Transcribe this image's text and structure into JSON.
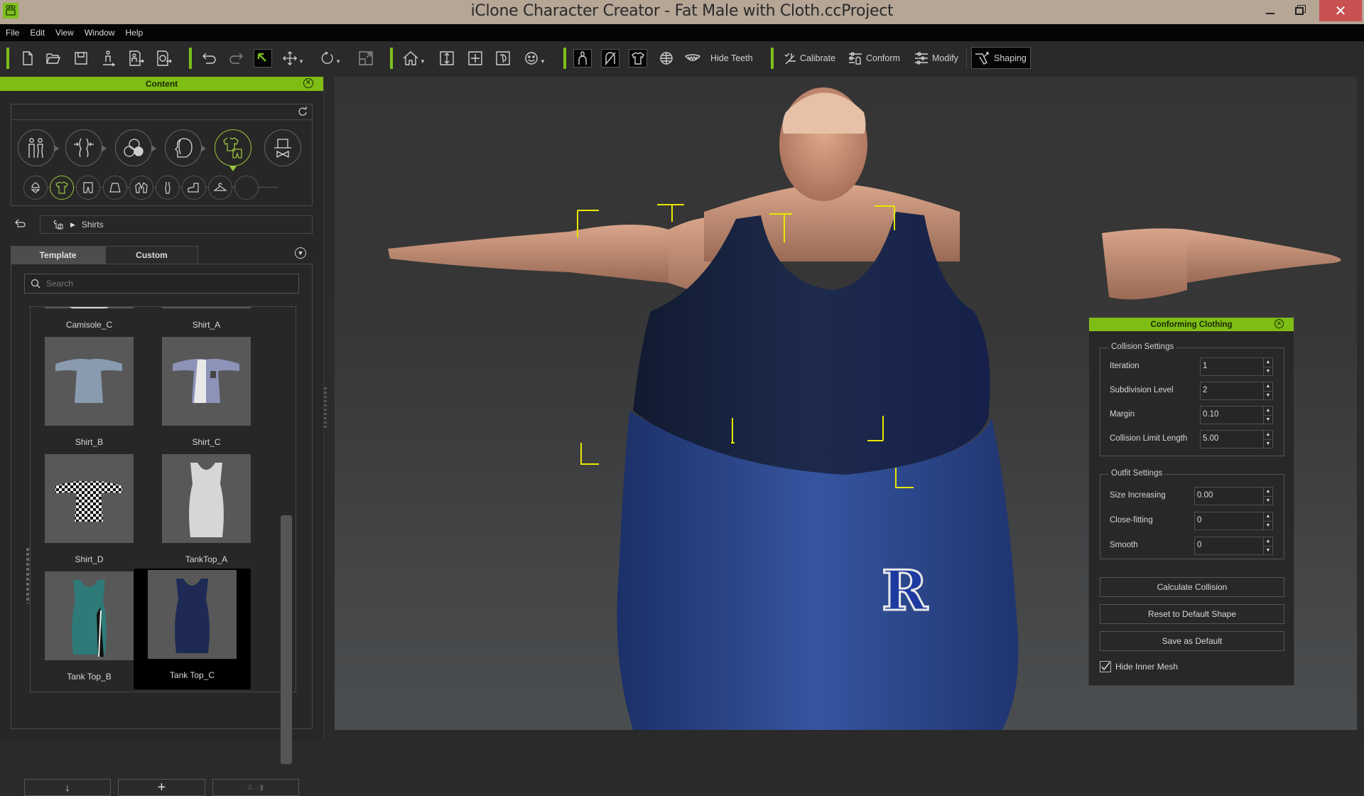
{
  "window": {
    "title": "iClone Character Creator - Fat Male with Cloth.ccProject",
    "controls": {
      "minimize": "—",
      "maximize": "❐",
      "close": "✕"
    }
  },
  "menu": [
    "File",
    "Edit",
    "View",
    "Window",
    "Help"
  ],
  "toolbar": {
    "file_group": [
      "new-file-icon",
      "open-folder-icon",
      "save-icon",
      "export-character-icon",
      "export-fbx-icon",
      "export-obj-icon"
    ],
    "edit_group": [
      "undo-icon",
      "redo-icon",
      "select-arrow-icon",
      "move-icon",
      "rotate-icon",
      "scale-icon"
    ],
    "camera_group": [
      "home-camera-icon",
      "fit-vertical-icon",
      "fit-all-icon",
      "orbit-icon",
      "face-cam-icon"
    ],
    "view_group": [
      "show-body-icon",
      "hide-hair-icon",
      "show-cloth-icon",
      "wireframe-globe-icon",
      "teeth-icon"
    ],
    "hide_teeth_label": "Hide Teeth",
    "calibrate_label": "Calibrate",
    "conform_label": "Conform",
    "modify_label": "Modify",
    "shaping_label": "Shaping",
    "accent": "#7cc01c"
  },
  "content_panel": {
    "title": "Content",
    "categories": [
      {
        "icon": "body-template-icon",
        "active": false
      },
      {
        "icon": "morph-icon",
        "active": false
      },
      {
        "icon": "material-skin-icon",
        "active": false
      },
      {
        "icon": "head-hair-icon",
        "active": false
      },
      {
        "icon": "cloth-icon",
        "active": true
      },
      {
        "icon": "accessory-hat-icon",
        "active": false
      }
    ],
    "subcategories": [
      {
        "icon": "underwear-icon",
        "active": false
      },
      {
        "icon": "shirt-icon",
        "active": true
      },
      {
        "icon": "pants-icon",
        "active": false
      },
      {
        "icon": "skirt-icon",
        "active": false
      },
      {
        "icon": "jacket-icon",
        "active": false
      },
      {
        "icon": "dress-icon",
        "active": false
      },
      {
        "icon": "shoes-icon",
        "active": false
      },
      {
        "icon": "hanger-icon",
        "active": false
      },
      {
        "icon": "empty-slot-icon",
        "active": false
      }
    ],
    "breadcrumb": [
      "cloth-icon",
      "Shirts"
    ],
    "tabs": {
      "template": "Template",
      "custom": "Custom",
      "active": "Template"
    },
    "search_placeholder": "Search",
    "items": [
      {
        "name": "Camisole_C",
        "selected": false,
        "color": "#cfcfcf"
      },
      {
        "name": "Shirt_A",
        "selected": false,
        "color": "#585858"
      },
      {
        "name": "Shirt_B",
        "selected": false,
        "color": "#8a9bb0"
      },
      {
        "name": "Shirt_C",
        "selected": false,
        "color": "#8d92b8"
      },
      {
        "name": "Shirt_D",
        "selected": false,
        "color": "#222222"
      },
      {
        "name": "TankTop_A",
        "selected": false,
        "color": "#d6d6d6"
      },
      {
        "name": "Tank Top_B",
        "selected": false,
        "color": "#2e7a78"
      },
      {
        "name": "Tank Top_C",
        "selected": true,
        "color": "#1e2a55"
      }
    ],
    "bottom_buttons": [
      {
        "icon": "apply-down-arrow-icon",
        "label": "↓",
        "enabled": true
      },
      {
        "icon": "add-plus-icon",
        "label": "+",
        "enabled": true
      },
      {
        "icon": "transfer-icon",
        "label": "Δ→▮",
        "enabled": false
      }
    ]
  },
  "conforming_clothing": {
    "title": "Conforming Clothing",
    "collision_settings": {
      "legend": "Collision Settings",
      "fields": [
        {
          "label": "Iteration",
          "value": "1"
        },
        {
          "label": "Subdivision Level",
          "value": "2"
        },
        {
          "label": "Margin",
          "value": "0.10"
        },
        {
          "label": "Collision Limit Length",
          "value": "5.00"
        }
      ]
    },
    "outfit_settings": {
      "legend": "Outfit Settings",
      "fields": [
        {
          "label": "Size Increasing",
          "value": "0.00"
        },
        {
          "label": "Close-fitting",
          "value": "0"
        },
        {
          "label": "Smooth",
          "value": "0"
        }
      ]
    },
    "buttons": [
      "Calculate Collision",
      "Reset to Default Shape",
      "Save as Default"
    ],
    "hide_inner_mesh": {
      "label": "Hide Inner Mesh",
      "checked": true
    }
  },
  "viewport": {
    "character": "Fat Male with Cloth",
    "selection_color": "#e8e800",
    "garment_top_color": "#1c2a4a",
    "garment_pants_color": "#2c4a8c",
    "pants_logo": "R"
  }
}
